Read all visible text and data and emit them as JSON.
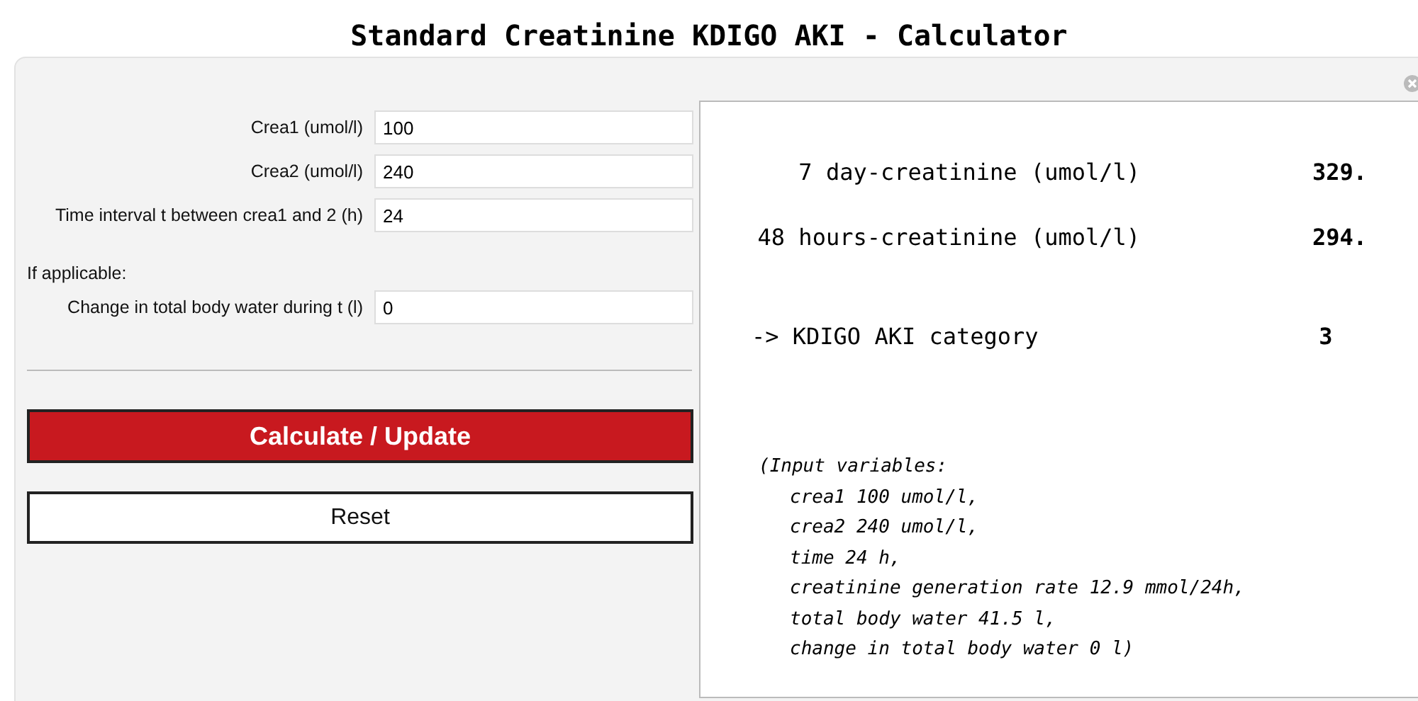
{
  "title": "Standard Creatinine KDIGO AKI - Calculator",
  "inputs": [
    {
      "label": "Crea1 (umol/l)",
      "value": "100"
    },
    {
      "label": "Crea2 (umol/l)",
      "value": "240"
    },
    {
      "label": "Time interval t between crea1 and 2 (h)",
      "value": "24"
    }
  ],
  "optional_heading": "If applicable:",
  "optional_inputs": [
    {
      "label": "Change in total body water during t (l)",
      "value": "0"
    }
  ],
  "buttons": [
    {
      "label": "Calculate / Update",
      "kind": "primary"
    },
    {
      "label": "Reset",
      "kind": "secondary"
    }
  ],
  "results": [
    {
      "label": "7 day-creatinine (umol/l)",
      "value": "329.",
      "kind": "measure"
    },
    {
      "label": "48 hours-creatinine (umol/l)",
      "value": "294.",
      "kind": "measure"
    },
    {
      "label": "-> KDIGO AKI category",
      "value": "3",
      "kind": "category"
    }
  ],
  "input_summary": {
    "heading": "(Input variables:",
    "lines": [
      "crea1 100 umol/l,",
      "crea2 240 umol/l,",
      "time 24 h,",
      "creatinine generation rate 12.9 mmol/24h,",
      "total body water 41.5 l,",
      "change in total body water 0 l)"
    ]
  }
}
